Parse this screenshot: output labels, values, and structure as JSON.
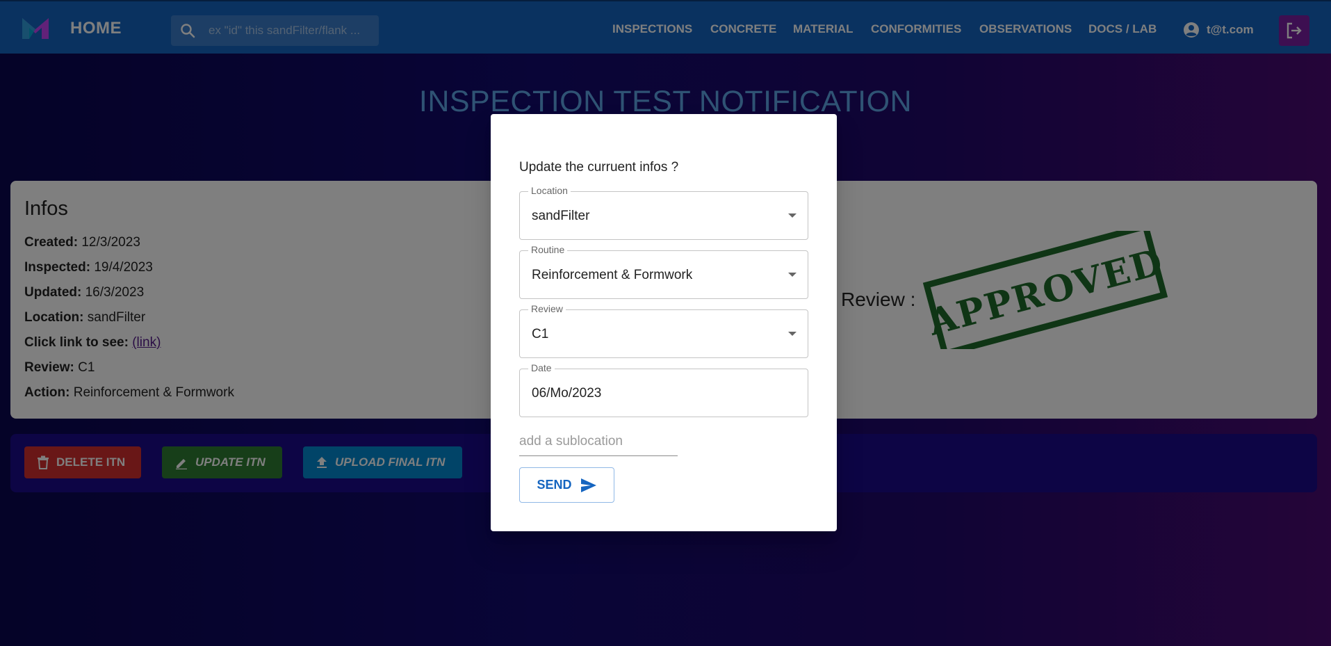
{
  "appbar": {
    "home_label": "HOME",
    "search_placeholder": "ex \"id\" this sandFilter/flank ...",
    "nav": [
      "INSPECTIONS",
      "CONCRETE",
      "MATERIAL",
      "CONFORMITIES",
      "OBSERVATIONS",
      "DOCS / LAB"
    ],
    "user_email": "t@t.com"
  },
  "page": {
    "title": "INSPECTION TEST NOTIFICATION"
  },
  "infos": {
    "title": "Infos",
    "created_label": "Created:",
    "created_value": "12/3/2023",
    "inspected_label": "Inspected:",
    "inspected_value": "19/4/2023",
    "updated_label": "Updated:",
    "updated_value": "16/3/2023",
    "location_label": "Location:",
    "location_value": "sandFilter",
    "link_label": "Click link to see:",
    "link_text": "(link)",
    "review_label": "Review:",
    "review_value": "C1",
    "action_label": "Action:",
    "action_value": "Reinforcement & Formwork",
    "review_stamp_label": "Review :",
    "stamp_text": "APPROVED"
  },
  "actions": {
    "delete": "DELETE ITN",
    "update": "UPDATE ITN",
    "upload": "UPLOAD FINAL ITN"
  },
  "dialog": {
    "title": "Update the curruent infos ?",
    "location_label": "Location",
    "location_value": "sandFilter",
    "routine_label": "Routine",
    "routine_value": "Reinforcement & Formwork",
    "review_label": "Review",
    "review_value": "C1",
    "date_label": "Date",
    "date_value": "06/Mo/2023",
    "sublocation_placeholder": "add a sublocation",
    "send_label": "SEND"
  },
  "colors": {
    "appbar": "#1565c0",
    "logout": "#7b1fa2",
    "stamp": "#1f6b2a"
  }
}
